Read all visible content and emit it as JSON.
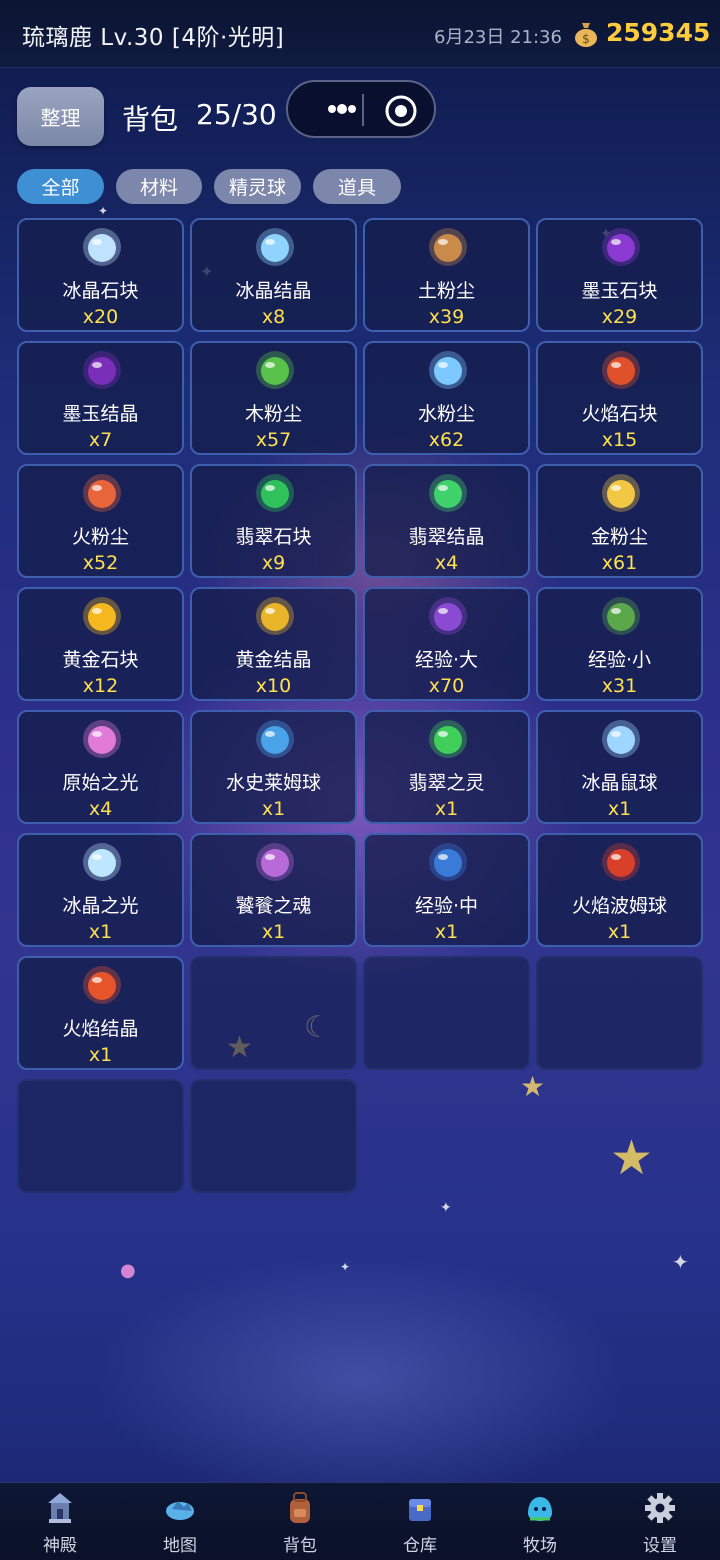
{
  "header": {
    "player_title": "琉璃鹿 Lv.30 [4阶·光明]",
    "datetime": "6月23日 21:36",
    "coins": "259345"
  },
  "toolbar": {
    "sort_label": "整理",
    "bag_label": "背包",
    "bag_count": "25/30"
  },
  "tabs": [
    {
      "label": "全部",
      "active": true
    },
    {
      "label": "材料",
      "active": false
    },
    {
      "label": "精灵球",
      "active": false
    },
    {
      "label": "道具",
      "active": false
    }
  ],
  "items": [
    {
      "name": "冰晶石块",
      "qty": "x20",
      "icon": "ice-stone-icon",
      "color": "#bfe3ff"
    },
    {
      "name": "冰晶结晶",
      "qty": "x8",
      "icon": "ice-crystal-icon",
      "color": "#8fd3ff"
    },
    {
      "name": "土粉尘",
      "qty": "x39",
      "icon": "earth-dust-icon",
      "color": "#c98a4a"
    },
    {
      "name": "墨玉石块",
      "qty": "x29",
      "icon": "jade-ink-stone-icon",
      "color": "#8a3ad1"
    },
    {
      "name": "墨玉结晶",
      "qty": "x7",
      "icon": "jade-ink-crystal-icon",
      "color": "#7a2fb8"
    },
    {
      "name": "木粉尘",
      "qty": "x57",
      "icon": "wood-dust-icon",
      "color": "#58c24a"
    },
    {
      "name": "水粉尘",
      "qty": "x62",
      "icon": "water-dust-icon",
      "color": "#7cc8ff"
    },
    {
      "name": "火焰石块",
      "qty": "x15",
      "icon": "fire-stone-icon",
      "color": "#e0502a"
    },
    {
      "name": "火粉尘",
      "qty": "x52",
      "icon": "fire-dust-icon",
      "color": "#e8643a"
    },
    {
      "name": "翡翠石块",
      "qty": "x9",
      "icon": "emerald-stone-icon",
      "color": "#2fc25a"
    },
    {
      "name": "翡翠结晶",
      "qty": "x4",
      "icon": "emerald-crystal-icon",
      "color": "#3fd16a"
    },
    {
      "name": "金粉尘",
      "qty": "x61",
      "icon": "gold-dust-icon",
      "color": "#f2c744"
    },
    {
      "name": "黄金石块",
      "qty": "x12",
      "icon": "gold-stone-icon",
      "color": "#f5b81e"
    },
    {
      "name": "黄金结晶",
      "qty": "x10",
      "icon": "gold-crystal-icon",
      "color": "#e8b52a"
    },
    {
      "name": "经验·大",
      "qty": "x70",
      "icon": "exp-book-large-icon",
      "color": "#8a4ad1"
    },
    {
      "name": "经验·小",
      "qty": "x31",
      "icon": "exp-book-small-icon",
      "color": "#5aa84a"
    },
    {
      "name": "原始之光",
      "qty": "x4",
      "icon": "primal-light-icon",
      "color": "#e27ad8"
    },
    {
      "name": "水史莱姆球",
      "qty": "x1",
      "icon": "water-slime-ball-icon",
      "color": "#4aa2e8"
    },
    {
      "name": "翡翠之灵",
      "qty": "x1",
      "icon": "emerald-spirit-icon",
      "color": "#3fcf5a"
    },
    {
      "name": "冰晶鼠球",
      "qty": "x1",
      "icon": "ice-mouse-ball-icon",
      "color": "#9fd6ff"
    },
    {
      "name": "冰晶之光",
      "qty": "x1",
      "icon": "ice-light-icon",
      "color": "#bde6ff"
    },
    {
      "name": "饕餮之魂",
      "qty": "x1",
      "icon": "taotie-soul-icon",
      "color": "#b86ad8"
    },
    {
      "name": "经验·中",
      "qty": "x1",
      "icon": "exp-book-medium-icon",
      "color": "#3a7ad8"
    },
    {
      "name": "火焰波姆球",
      "qty": "x1",
      "icon": "fire-pom-ball-icon",
      "color": "#d8402a"
    },
    {
      "name": "火焰结晶",
      "qty": "x1",
      "icon": "fire-crystal-icon",
      "color": "#e8542a"
    }
  ],
  "nav": [
    {
      "label": "神殿",
      "icon": "temple-icon"
    },
    {
      "label": "地图",
      "icon": "map-icon"
    },
    {
      "label": "背包",
      "icon": "backpack-icon"
    },
    {
      "label": "仓库",
      "icon": "warehouse-icon"
    },
    {
      "label": "牧场",
      "icon": "ranch-icon"
    },
    {
      "label": "设置",
      "icon": "gear-icon"
    }
  ]
}
